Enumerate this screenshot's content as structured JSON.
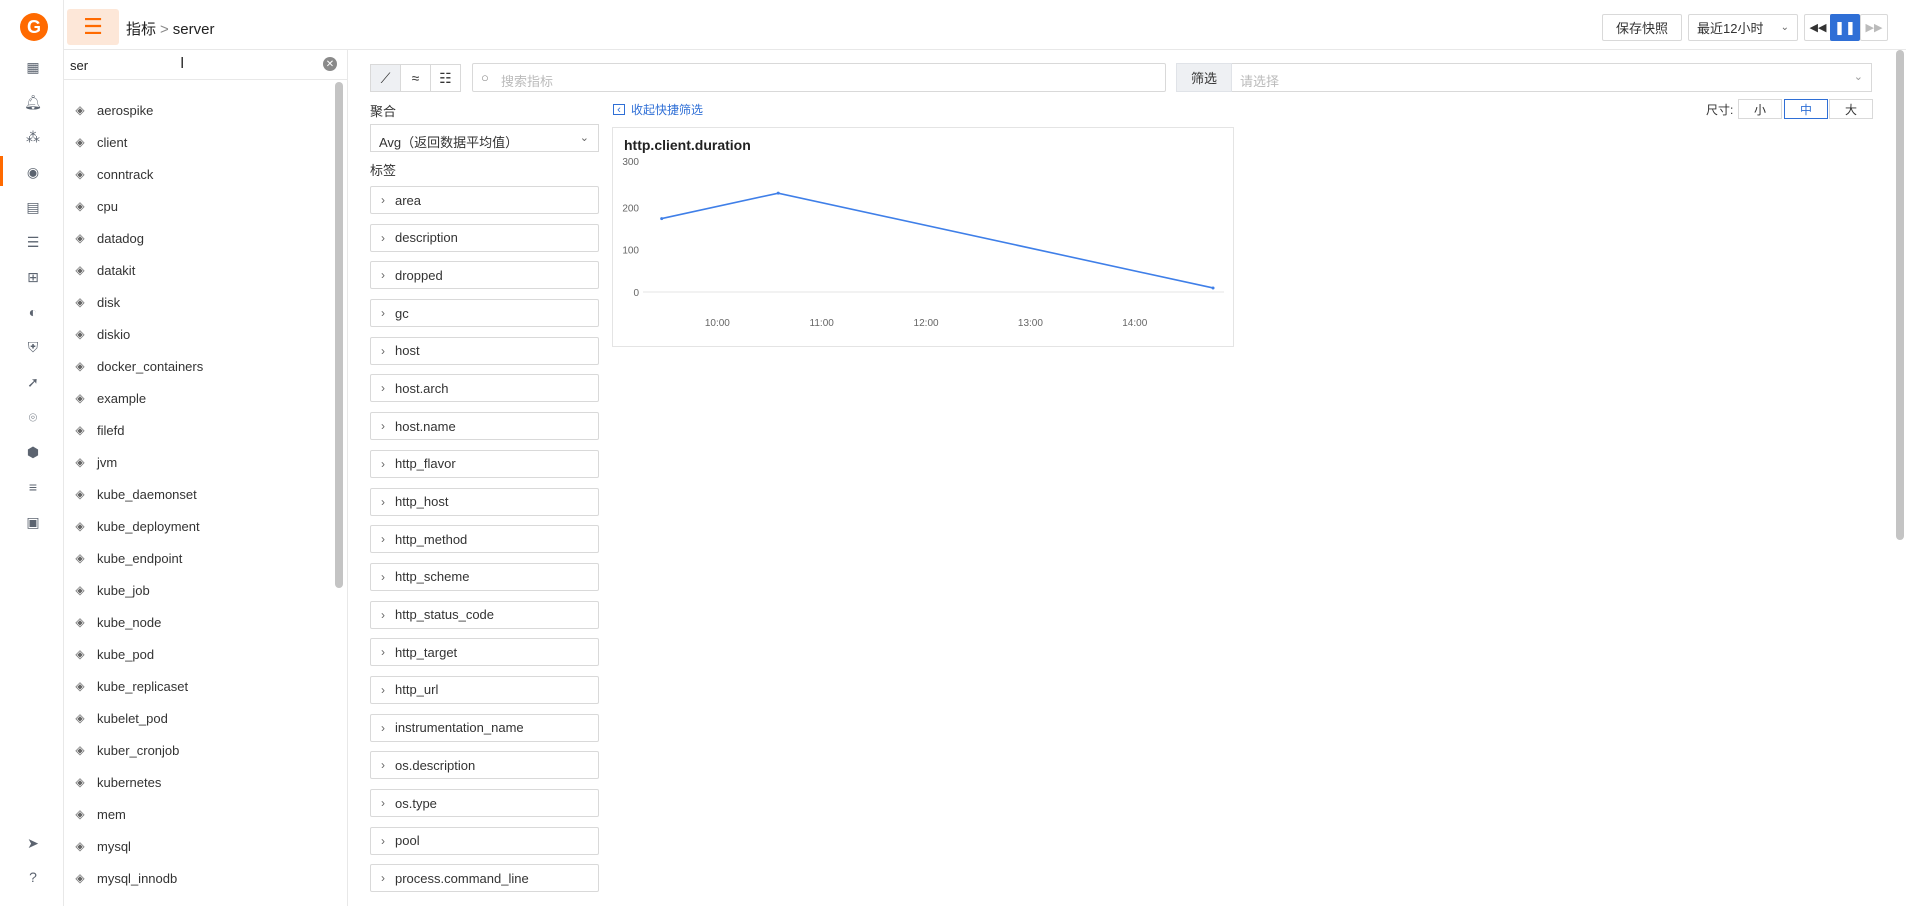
{
  "rail": {
    "logo": "G",
    "icons": [
      "dashboard-icon",
      "bell-icon",
      "cluster-icon",
      "metrics-icon",
      "calendar-icon",
      "filter-icon",
      "apps-icon",
      "satellite-icon",
      "shield-icon",
      "rocket-icon",
      "signal-icon",
      "box-icon",
      "sliders-icon",
      "archive-icon",
      "send-icon",
      "help-icon"
    ]
  },
  "header": {
    "crumb_root": "指标",
    "crumb_sep": ">",
    "crumb_current": "server",
    "save_label": "保存快照",
    "range_label": "最近12小时"
  },
  "sidebar": {
    "search_value": "ser",
    "items": [
      "aerospike",
      "client",
      "conntrack",
      "cpu",
      "datadog",
      "datakit",
      "disk",
      "diskio",
      "docker_containers",
      "example",
      "filefd",
      "jvm",
      "kube_daemonset",
      "kube_deployment",
      "kube_endpoint",
      "kube_job",
      "kube_node",
      "kube_pod",
      "kube_replicaset",
      "kubelet_pod",
      "kuber_cronjob",
      "kubernetes",
      "mem",
      "mysql",
      "mysql_innodb"
    ]
  },
  "toolbar": {
    "search_placeholder": "搜索指标",
    "filter_label": "筛选",
    "filter_placeholder": "请选择"
  },
  "panel": {
    "agg_label": "聚合",
    "agg_value": "Avg（返回数据平均值）",
    "tag_label": "标签",
    "tags": [
      "area",
      "description",
      "dropped",
      "gc",
      "host",
      "host.arch",
      "host.name",
      "http_flavor",
      "http_host",
      "http_method",
      "http_scheme",
      "http_status_code",
      "http_target",
      "http_url",
      "instrumentation_name",
      "os.description",
      "os.type",
      "pool",
      "process.command_line"
    ]
  },
  "view": {
    "collapse_label": "收起快捷筛选",
    "size_label": "尺寸:",
    "size_small": "小",
    "size_medium": "中",
    "size_large": "大",
    "active_size": "中"
  },
  "chart_data": {
    "type": "line",
    "title": "http.client.duration",
    "xlabel": "",
    "ylabel": "",
    "x_ticks": [
      "10:00",
      "11:00",
      "12:00",
      "13:00",
      "14:00"
    ],
    "y_ticks": [
      0,
      100,
      200,
      300
    ],
    "ylim": [
      0,
      300
    ],
    "x": [
      "09:28",
      "10:35",
      "14:45"
    ],
    "values": [
      187,
      250,
      15
    ],
    "color": "#3f7fe8",
    "grid": false
  }
}
